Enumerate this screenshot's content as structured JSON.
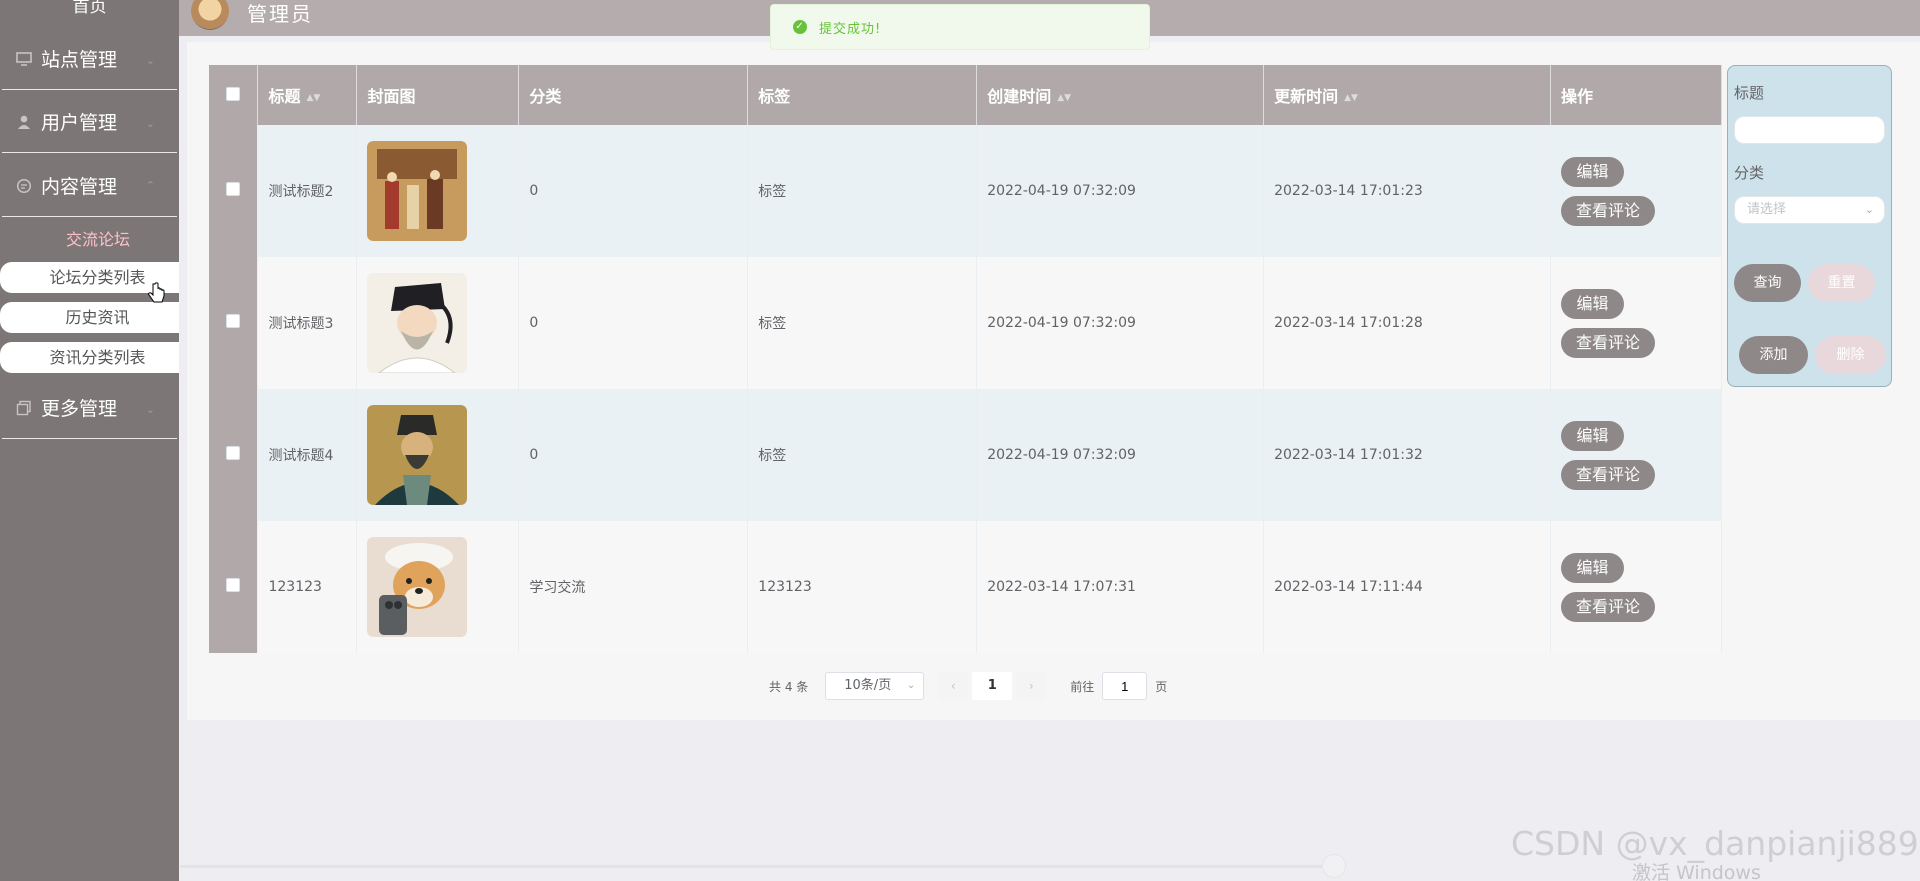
{
  "sidebar": {
    "home": "首页",
    "groups": [
      {
        "label": "站点管理",
        "icon": "monitor-icon"
      },
      {
        "label": "用户管理",
        "icon": "user-icon"
      },
      {
        "label": "内容管理",
        "icon": "chat-icon"
      },
      {
        "label": "更多管理",
        "icon": "copy-icon"
      }
    ],
    "submenu_title": "交流论坛",
    "submenu_items": [
      "论坛分类列表",
      "历史资讯",
      "资讯分类列表"
    ]
  },
  "header": {
    "title": "管理员",
    "toast": "提交成功!"
  },
  "table": {
    "columns": [
      "标题",
      "封面图",
      "分类",
      "标签",
      "创建时间",
      "更新时间",
      "操作"
    ],
    "rows": [
      {
        "title": "测试标题2",
        "cover": "painting-icon",
        "category": "0",
        "tag": "标签",
        "created": "2022-04-19 07:32:09",
        "updated": "2022-03-14 17:01:23"
      },
      {
        "title": "测试标题3",
        "cover": "portrait-icon",
        "category": "0",
        "tag": "标签",
        "created": "2022-04-19 07:32:09",
        "updated": "2022-03-14 17:01:28"
      },
      {
        "title": "测试标题4",
        "cover": "portrait-icon",
        "category": "0",
        "tag": "标签",
        "created": "2022-04-19 07:32:09",
        "updated": "2022-03-14 17:01:32"
      },
      {
        "title": "123123",
        "cover": "dog-icon",
        "category": "学习交流",
        "tag": "123123",
        "created": "2022-03-14 17:07:31",
        "updated": "2022-03-14 17:11:44"
      }
    ],
    "actions": {
      "edit": "编辑",
      "comments": "查看评论"
    }
  },
  "search_panel": {
    "title_label": "标题",
    "title_value": "",
    "category_label": "分类",
    "category_placeholder": "请选择",
    "query": "查询",
    "reset": "重置",
    "add": "添加",
    "delete": "删除"
  },
  "pagination": {
    "total": "共 4 条",
    "page_size": "10条/页",
    "current_page": "1",
    "goto_prefix": "前往",
    "goto_value": "1",
    "goto_suffix": "页"
  },
  "watermark": "CSDN @vx_danpianji889",
  "windows_notice": "激活 Windows",
  "colors": {
    "sidebar": "#7c7677",
    "header": "#b1a9a9",
    "button": "#8e8889",
    "panel": "#cde2eb",
    "accent_pink": "#ffc0cb",
    "success": "#67c23a"
  }
}
